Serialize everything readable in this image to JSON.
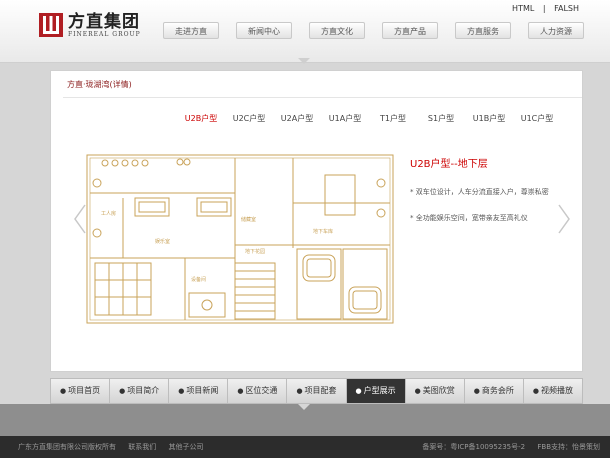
{
  "header": {
    "logo_cn": "方直集团",
    "logo_en": "FINEREAL GROUP",
    "links": [
      "HTML",
      "|",
      "FALSH"
    ],
    "nav": [
      "走进方直",
      "新闻中心",
      "方直文化",
      "方直产品",
      "方直服务",
      "人力资源"
    ]
  },
  "main": {
    "breadcrumb": "方直·珑湖湾(详情)",
    "tabs": [
      "U2B户型",
      "U2C户型",
      "U2A户型",
      "U1A户型",
      "T1户型",
      "S1户型",
      "U1B户型",
      "U1C户型"
    ],
    "plan_title": "U2B户型--地下层",
    "notes": [
      "* 双车位设计，人车分流直接入户，尊崇私密",
      "* 全功能娱乐空间，宽带亲友至高礼仪"
    ],
    "room_labels": [
      "地下车库",
      "娱乐室",
      "储藏室",
      "地下花园",
      "工人房",
      "设备间"
    ]
  },
  "bottom_nav": [
    "项目首页",
    "项目简介",
    "项目新闻",
    "区位交通",
    "项目配套",
    "户型展示",
    "美图欣赏",
    "商务会所",
    "视频播放"
  ],
  "bottom_nav_active": "户型展示",
  "footer": {
    "left": [
      "广东方直集团有限公司版权所有",
      "联系我们",
      "其他子公司"
    ],
    "right": [
      "备案号：粤ICP备10095235号-2",
      "FBB支持：怡景策划"
    ]
  },
  "colors": {
    "accent": "#cc0000",
    "brand_red": "#b01e23",
    "plan": "#c9a35a"
  }
}
